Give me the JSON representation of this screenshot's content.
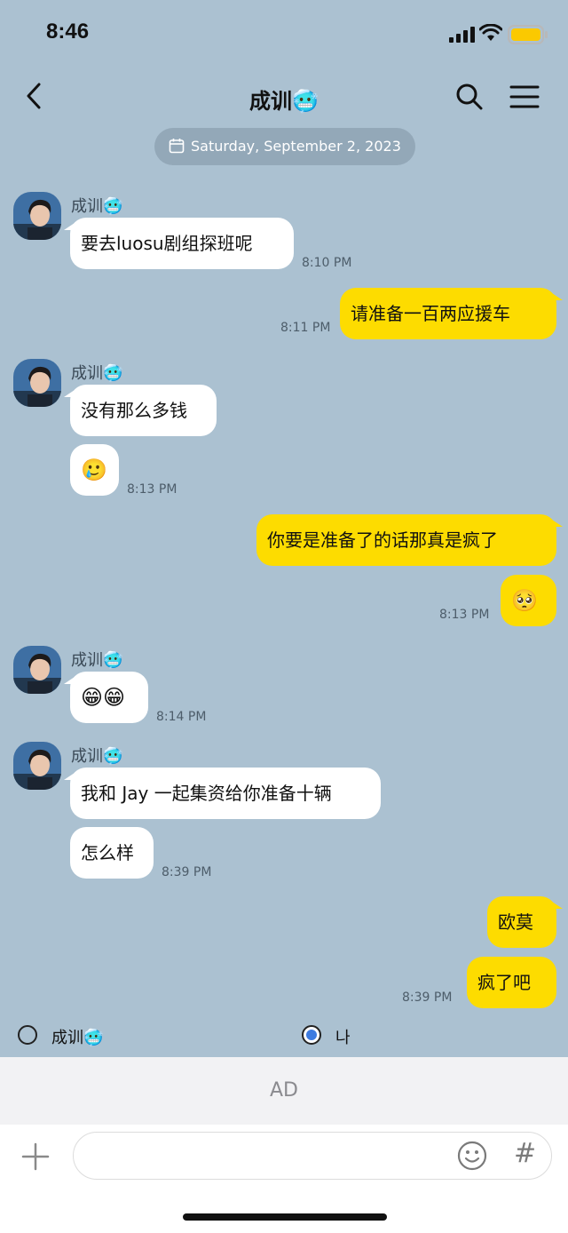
{
  "status_bar": {
    "time": "8:46"
  },
  "header": {
    "title": "成训",
    "title_emoji": "🥶"
  },
  "date_divider": "Saturday, September 2, 2023",
  "messages": [
    {
      "sender": "成训",
      "sender_emoji": "🥶",
      "bubbles": [
        "要去luosu剧组探班呢"
      ],
      "time": "8:10 PM"
    },
    {
      "sender": "me",
      "bubbles": [
        "请准备一百两应援车"
      ],
      "time": "8:11 PM"
    },
    {
      "sender": "成训",
      "sender_emoji": "🥶",
      "bubbles": [
        "没有那么多钱",
        "🥲"
      ],
      "time": "8:13 PM"
    },
    {
      "sender": "me",
      "bubbles": [
        "你要是准备了的话那真是疯了",
        "🥺"
      ],
      "time": "8:13 PM"
    },
    {
      "sender": "成训",
      "sender_emoji": "🥶",
      "bubbles": [
        "😁😁"
      ],
      "time": "8:14 PM"
    },
    {
      "sender": "成训",
      "sender_emoji": "🥶",
      "bubbles": [
        "我和 Jay 一起集资给你准备十辆",
        "怎么样"
      ],
      "time": "8:39 PM"
    },
    {
      "sender": "me",
      "bubbles": [
        "欧莫",
        "疯了吧"
      ],
      "time": "8:39 PM"
    }
  ],
  "selector": {
    "option_a": "成训",
    "option_a_emoji": "🥶",
    "option_b": "나",
    "selected": "나"
  },
  "ad_label": "AD",
  "colors": {
    "chat_bg": "#abc1d1",
    "my_bubble": "#fddc00",
    "their_bubble": "#ffffff",
    "radio_selected": "#3d7be0"
  }
}
